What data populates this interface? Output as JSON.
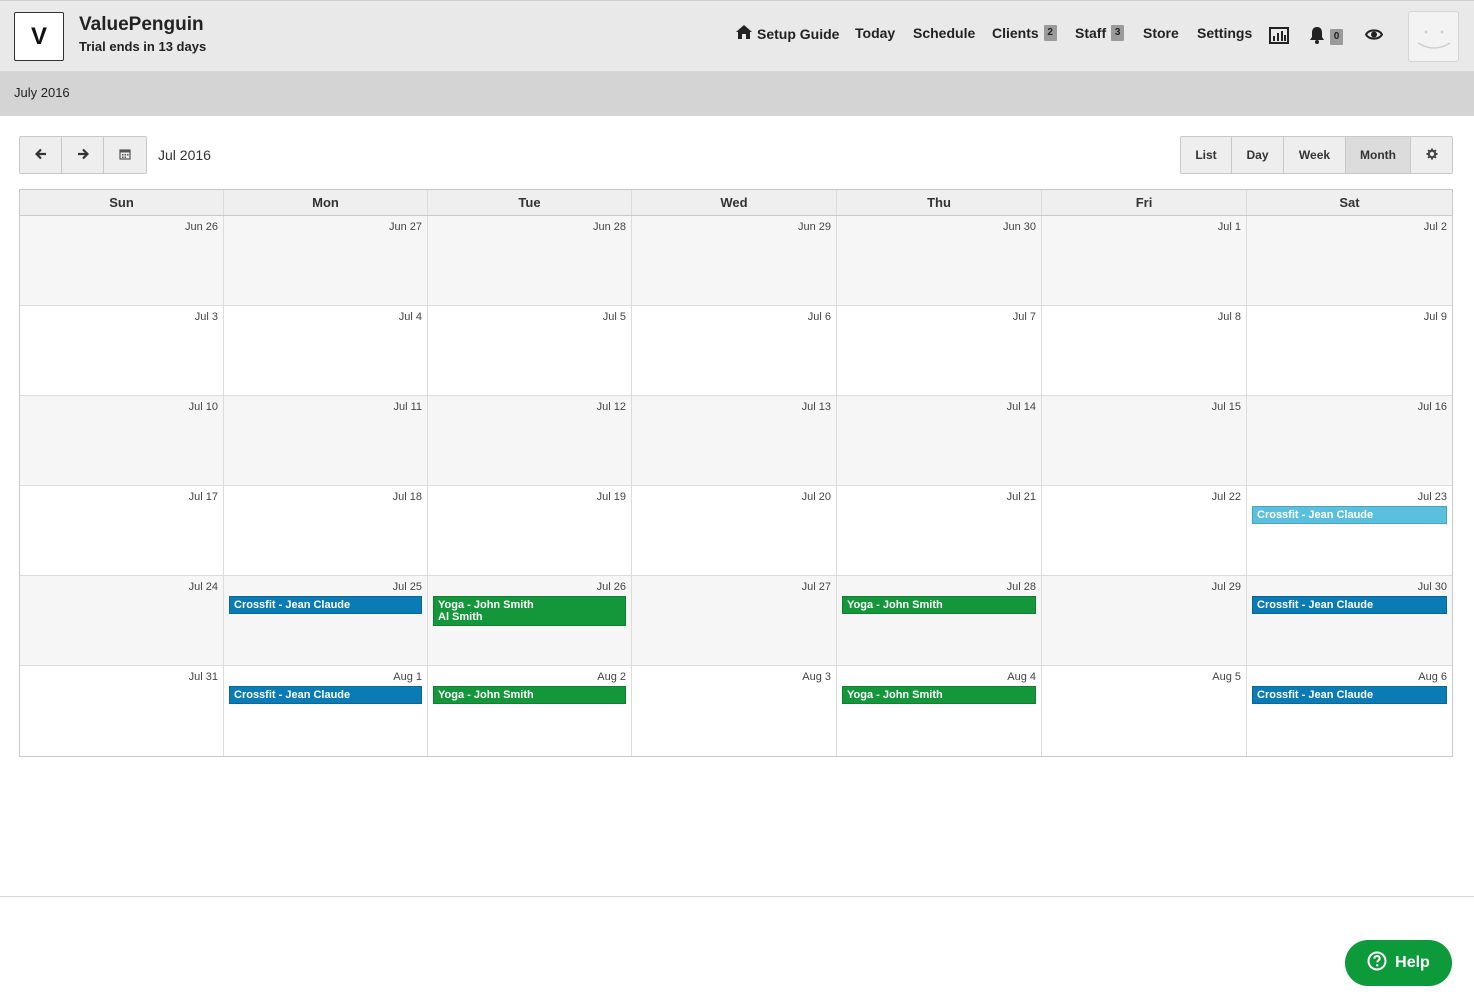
{
  "brand": {
    "logo_letter": "V",
    "name": "ValuePenguin",
    "subtitle": "Trial ends in 13 days"
  },
  "nav": {
    "setup_guide": "Setup Guide",
    "today": "Today",
    "schedule": "Schedule",
    "clients": "Clients",
    "clients_count": "2",
    "staff": "Staff",
    "staff_count": "3",
    "store": "Store",
    "settings": "Settings",
    "notifications_count": "0"
  },
  "subheader": {
    "title": "July 2016"
  },
  "toolbar": {
    "range_label": "Jul 2016",
    "views": [
      "List",
      "Day",
      "Week",
      "Month"
    ],
    "active_view": "Month"
  },
  "calendar": {
    "weekdays": [
      "Sun",
      "Mon",
      "Tue",
      "Wed",
      "Thu",
      "Fri",
      "Sat"
    ],
    "weeks": [
      [
        "Jun 26",
        "Jun 27",
        "Jun 28",
        "Jun 29",
        "Jun 30",
        "Jul 1",
        "Jul 2"
      ],
      [
        "Jul 3",
        "Jul 4",
        "Jul 5",
        "Jul 6",
        "Jul 7",
        "Jul 8",
        "Jul 9"
      ],
      [
        "Jul 10",
        "Jul 11",
        "Jul 12",
        "Jul 13",
        "Jul 14",
        "Jul 15",
        "Jul 16"
      ],
      [
        "Jul 17",
        "Jul 18",
        "Jul 19",
        "Jul 20",
        "Jul 21",
        "Jul 22",
        "Jul 23"
      ],
      [
        "Jul 24",
        "Jul 25",
        "Jul 26",
        "Jul 27",
        "Jul 28",
        "Jul 29",
        "Jul 30"
      ],
      [
        "Jul 31",
        "Aug 1",
        "Aug 2",
        "Aug 3",
        "Aug 4",
        "Aug 5",
        "Aug 6"
      ]
    ],
    "events": [
      {
        "week": 3,
        "day": 6,
        "lines": [
          "Crossfit - Jean Claude"
        ],
        "color": "#5bc0de"
      },
      {
        "week": 4,
        "day": 1,
        "lines": [
          "Crossfit - Jean Claude"
        ],
        "color": "#0a7bb5"
      },
      {
        "week": 4,
        "day": 2,
        "lines": [
          "Yoga - John Smith",
          "Al Smith"
        ],
        "color": "#13973a"
      },
      {
        "week": 4,
        "day": 4,
        "lines": [
          "Yoga - John Smith"
        ],
        "color": "#13973a"
      },
      {
        "week": 4,
        "day": 6,
        "lines": [
          "Crossfit - Jean Claude"
        ],
        "color": "#0a7bb5"
      },
      {
        "week": 5,
        "day": 1,
        "lines": [
          "Crossfit - Jean Claude"
        ],
        "color": "#0a7bb5"
      },
      {
        "week": 5,
        "day": 2,
        "lines": [
          "Yoga - John Smith"
        ],
        "color": "#13973a"
      },
      {
        "week": 5,
        "day": 4,
        "lines": [
          "Yoga - John Smith"
        ],
        "color": "#13973a"
      },
      {
        "week": 5,
        "day": 6,
        "lines": [
          "Crossfit - Jean Claude"
        ],
        "color": "#0a7bb5"
      }
    ]
  },
  "help": {
    "label": "Help"
  }
}
